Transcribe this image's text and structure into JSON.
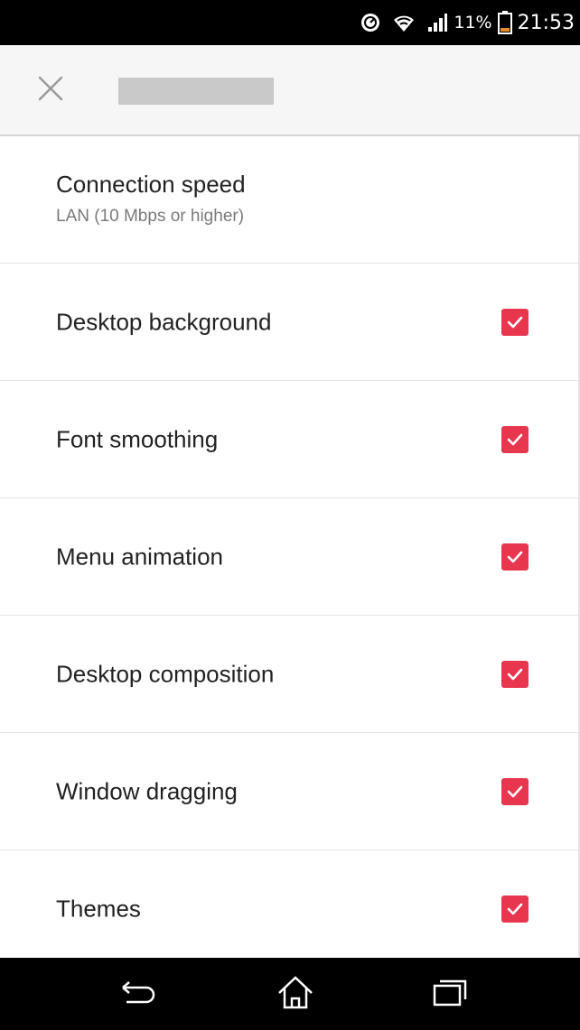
{
  "status_bar": {
    "battery_percent": "11%",
    "time": "21:53",
    "icons": [
      "data-saver-icon",
      "wifi-icon",
      "signal-icon",
      "battery-icon"
    ]
  },
  "app_bar": {
    "close_icon": "close-icon"
  },
  "settings": {
    "connection_speed": {
      "title": "Connection speed",
      "value": "LAN (10 Mbps or higher)"
    },
    "items": [
      {
        "label": "Desktop background",
        "checked": true
      },
      {
        "label": "Font smoothing",
        "checked": true
      },
      {
        "label": "Menu animation",
        "checked": true
      },
      {
        "label": "Desktop composition",
        "checked": true
      },
      {
        "label": "Window dragging",
        "checked": true
      },
      {
        "label": "Themes",
        "checked": true
      }
    ]
  },
  "nav_bar": {
    "icons": [
      "back-icon",
      "home-icon",
      "recent-apps-icon"
    ]
  },
  "colors": {
    "accent": "#e8364f",
    "status_bar": "#000000",
    "app_bar": "#f6f6f6",
    "nav_bar": "#000000"
  }
}
